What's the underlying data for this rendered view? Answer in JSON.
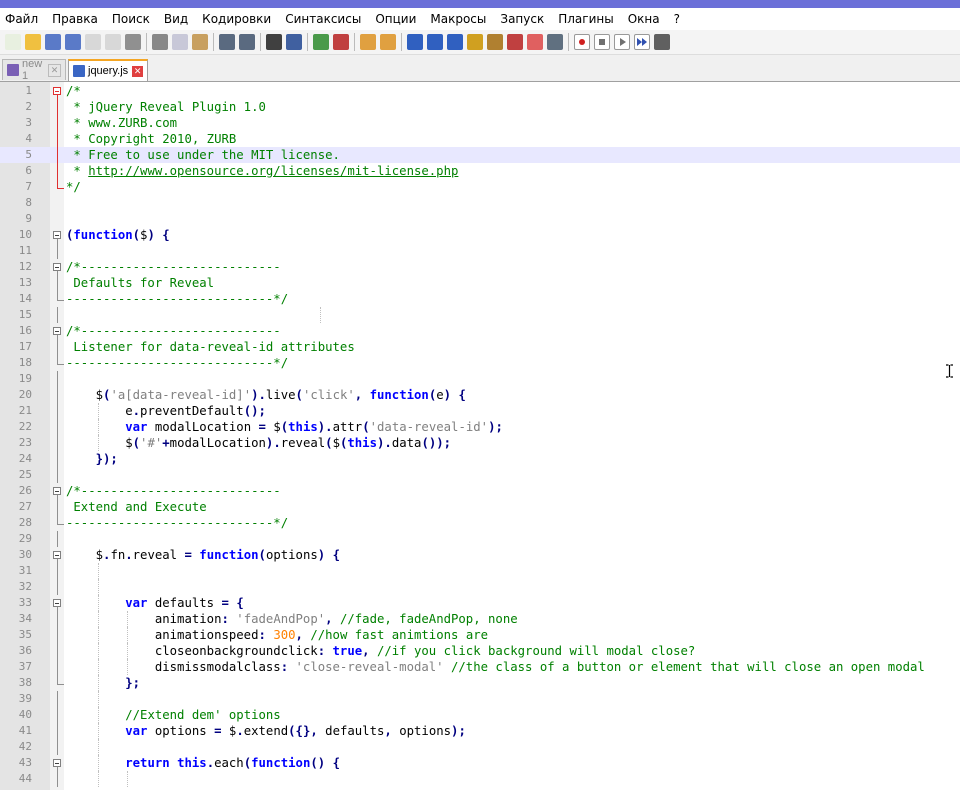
{
  "menu": [
    "Файл",
    "Правка",
    "Поиск",
    "Вид",
    "Кодировки",
    "Синтаксисы",
    "Опции",
    "Макросы",
    "Запуск",
    "Плагины",
    "Окна",
    "?"
  ],
  "toolbar_icons": [
    "new-file-icon",
    "open-file-icon",
    "save-icon",
    "save-all-icon",
    "close-icon",
    "close-all-icon",
    "print-icon",
    "cut-icon",
    "copy-icon",
    "paste-icon",
    "undo-icon",
    "redo-icon",
    "find-icon",
    "replace-icon",
    "zoom-in-icon",
    "zoom-out-icon",
    "sync-vertical-icon",
    "sync-horizontal-icon",
    "word-wrap-icon",
    "show-all-chars-icon",
    "indent-guide-icon",
    "user-lang-icon",
    "doc-map-icon",
    "function-list-icon",
    "folder-workspace-icon",
    "monitor-icon",
    "record-macro-icon",
    "stop-macro-icon",
    "play-macro-icon",
    "run-macro-multiple-icon",
    "save-macro-icon"
  ],
  "tabs": [
    {
      "label": "new 1",
      "active": false
    },
    {
      "label": "jquery.js",
      "active": true
    }
  ],
  "colors": {
    "comment": "#008000",
    "keyword": "#0000ff",
    "string": "#808080",
    "number": "#ff8000",
    "operator": "#000080",
    "fold_marker_red": "#e03030",
    "current_line": "#e8e8ff"
  },
  "editor": {
    "lines": [
      {
        "n": "1",
        "fold": "open-red",
        "segs": [
          [
            "cm",
            "/*"
          ]
        ]
      },
      {
        "n": "2",
        "fold": "line-red",
        "segs": [
          [
            "cm",
            " * jQuery Reveal Plugin 1.0"
          ]
        ]
      },
      {
        "n": "3",
        "fold": "line-red",
        "segs": [
          [
            "cm",
            " * www.ZURB.com"
          ]
        ]
      },
      {
        "n": "4",
        "fold": "line-red",
        "segs": [
          [
            "cm",
            " * Copyright 2010, ZURB"
          ]
        ]
      },
      {
        "n": "5",
        "fold": "line-red",
        "hl": true,
        "segs": [
          [
            "cm",
            " * Free to use under the MIT license."
          ]
        ]
      },
      {
        "n": "6",
        "fold": "line-red",
        "segs": [
          [
            "cm",
            " * "
          ],
          [
            "cmu",
            "http://www.opensource.org/licenses/mit-license.php"
          ]
        ]
      },
      {
        "n": "7",
        "fold": "end-red",
        "segs": [
          [
            "cm",
            "*/"
          ]
        ]
      },
      {
        "n": "8",
        "segs": []
      },
      {
        "n": "9",
        "segs": []
      },
      {
        "n": "10",
        "fold": "open",
        "segs": [
          [
            "op",
            "("
          ],
          [
            "kw",
            "function"
          ],
          [
            "op",
            "("
          ],
          [
            "",
            "$"
          ],
          [
            "op",
            ")"
          ],
          [
            "",
            " "
          ],
          [
            "op",
            "{"
          ]
        ]
      },
      {
        "n": "11",
        "fold": "line",
        "segs": []
      },
      {
        "n": "12",
        "fold": "open",
        "segs": [
          [
            "cm",
            "/*---------------------------"
          ]
        ]
      },
      {
        "n": "13",
        "fold": "line",
        "segs": [
          [
            "cm",
            " Defaults for Reveal"
          ]
        ]
      },
      {
        "n": "14",
        "fold": "end",
        "segs": [
          [
            "cm",
            "----------------------------*/"
          ]
        ]
      },
      {
        "n": "15",
        "fold": "line",
        "guides": [
          34
        ],
        "segs": []
      },
      {
        "n": "16",
        "fold": "open",
        "segs": [
          [
            "cm",
            "/*---------------------------"
          ]
        ]
      },
      {
        "n": "17",
        "fold": "line",
        "segs": [
          [
            "cm",
            " Listener for data-reveal-id attributes"
          ]
        ]
      },
      {
        "n": "18",
        "fold": "end",
        "segs": [
          [
            "cm",
            "----------------------------*/"
          ]
        ]
      },
      {
        "n": "19",
        "fold": "line",
        "segs": []
      },
      {
        "n": "20",
        "fold": "line",
        "segs": [
          [
            "",
            "    $"
          ],
          [
            "op",
            "("
          ],
          [
            "st",
            "'a[data-reveal-id]'"
          ],
          [
            "op",
            ")."
          ],
          [
            "",
            "live"
          ],
          [
            "op",
            "("
          ],
          [
            "st",
            "'click'"
          ],
          [
            "op",
            ", "
          ],
          [
            "kw",
            "function"
          ],
          [
            "op",
            "("
          ],
          [
            "",
            "e"
          ],
          [
            "op",
            ")"
          ],
          [
            "",
            " "
          ],
          [
            "op",
            "{"
          ]
        ]
      },
      {
        "n": "21",
        "fold": "line",
        "guides": [
          4
        ],
        "segs": [
          [
            "",
            "        e"
          ],
          [
            "op",
            "."
          ],
          [
            "",
            "preventDefault"
          ],
          [
            "op",
            "();"
          ]
        ]
      },
      {
        "n": "22",
        "fold": "line",
        "guides": [
          4
        ],
        "segs": [
          [
            "",
            " "
          ],
          [
            "kw",
            "       var"
          ],
          [
            "",
            " modalLocation "
          ],
          [
            "op",
            "="
          ],
          [
            "",
            " $"
          ],
          [
            "op",
            "("
          ],
          [
            "kw",
            "this"
          ],
          [
            "op",
            ")."
          ],
          [
            "",
            "attr"
          ],
          [
            "op",
            "("
          ],
          [
            "st",
            "'data-reveal-id'"
          ],
          [
            "op",
            ");"
          ]
        ]
      },
      {
        "n": "23",
        "fold": "line",
        "guides": [
          4
        ],
        "segs": [
          [
            "",
            "        $"
          ],
          [
            "op",
            "("
          ],
          [
            "st",
            "'#'"
          ],
          [
            "op",
            "+"
          ],
          [
            "",
            "modalLocation"
          ],
          [
            "op",
            ")."
          ],
          [
            "",
            "reveal"
          ],
          [
            "op",
            "("
          ],
          [
            "",
            "$"
          ],
          [
            "op",
            "("
          ],
          [
            "kw",
            "this"
          ],
          [
            "op",
            ")."
          ],
          [
            "",
            "data"
          ],
          [
            "op",
            "());"
          ]
        ]
      },
      {
        "n": "24",
        "fold": "line",
        "segs": [
          [
            "",
            "    "
          ],
          [
            "op",
            "});"
          ]
        ]
      },
      {
        "n": "25",
        "fold": "line",
        "segs": []
      },
      {
        "n": "26",
        "fold": "open",
        "segs": [
          [
            "cm",
            "/*---------------------------"
          ]
        ]
      },
      {
        "n": "27",
        "fold": "line",
        "segs": [
          [
            "cm",
            " Extend and Execute"
          ]
        ]
      },
      {
        "n": "28",
        "fold": "end",
        "segs": [
          [
            "cm",
            "----------------------------*/"
          ]
        ]
      },
      {
        "n": "29",
        "fold": "line",
        "segs": []
      },
      {
        "n": "30",
        "fold": "open",
        "segs": [
          [
            "",
            "    $"
          ],
          [
            "op",
            "."
          ],
          [
            "",
            "fn"
          ],
          [
            "op",
            "."
          ],
          [
            "",
            "reveal "
          ],
          [
            "op",
            "="
          ],
          [
            "",
            " "
          ],
          [
            "kw",
            "function"
          ],
          [
            "op",
            "("
          ],
          [
            "",
            "options"
          ],
          [
            "op",
            ")"
          ],
          [
            "",
            " "
          ],
          [
            "op",
            "{"
          ]
        ]
      },
      {
        "n": "31",
        "fold": "line",
        "guides": [
          4
        ],
        "segs": []
      },
      {
        "n": "32",
        "fold": "line",
        "guides": [
          4
        ],
        "segs": []
      },
      {
        "n": "33",
        "fold": "open",
        "guides": [
          4
        ],
        "segs": [
          [
            "",
            "        "
          ],
          [
            "kw",
            "var"
          ],
          [
            "",
            " defaults "
          ],
          [
            "op",
            "="
          ],
          [
            "",
            " "
          ],
          [
            "op",
            "{"
          ]
        ]
      },
      {
        "n": "34",
        "fold": "line",
        "guides": [
          4,
          8
        ],
        "segs": [
          [
            "",
            "            animation"
          ],
          [
            "op",
            ":"
          ],
          [
            "",
            " "
          ],
          [
            "st",
            "'fadeAndPop'"
          ],
          [
            "op",
            ","
          ],
          [
            "",
            " "
          ],
          [
            "cm",
            "//fade, fadeAndPop, none"
          ]
        ]
      },
      {
        "n": "35",
        "fold": "line",
        "guides": [
          4,
          8
        ],
        "segs": [
          [
            "",
            "            animationspeed"
          ],
          [
            "op",
            ":"
          ],
          [
            "",
            " "
          ],
          [
            "nm",
            "300"
          ],
          [
            "op",
            ","
          ],
          [
            "",
            " "
          ],
          [
            "cm",
            "//how fast animtions are"
          ]
        ]
      },
      {
        "n": "36",
        "fold": "line",
        "guides": [
          4,
          8
        ],
        "segs": [
          [
            "",
            "            closeonbackgroundclick"
          ],
          [
            "op",
            ":"
          ],
          [
            "",
            " "
          ],
          [
            "kw",
            "true"
          ],
          [
            "op",
            ","
          ],
          [
            "",
            " "
          ],
          [
            "cm",
            "//if you click background will modal close?"
          ]
        ]
      },
      {
        "n": "37",
        "fold": "line",
        "guides": [
          4,
          8
        ],
        "segs": [
          [
            "",
            "            dismissmodalclass"
          ],
          [
            "op",
            ":"
          ],
          [
            "",
            " "
          ],
          [
            "st",
            "'close-reveal-modal'"
          ],
          [
            "",
            " "
          ],
          [
            "cm",
            "//the class of a button or element that will close an open modal"
          ]
        ]
      },
      {
        "n": "38",
        "fold": "end",
        "guides": [
          4
        ],
        "segs": [
          [
            "",
            "        "
          ],
          [
            "op",
            "};"
          ]
        ]
      },
      {
        "n": "39",
        "fold": "line",
        "guides": [
          4
        ],
        "segs": []
      },
      {
        "n": "40",
        "fold": "line",
        "guides": [
          4
        ],
        "segs": [
          [
            "",
            "        "
          ],
          [
            "cm",
            "//Extend dem' options"
          ]
        ]
      },
      {
        "n": "41",
        "fold": "line",
        "guides": [
          4
        ],
        "segs": [
          [
            "",
            "        "
          ],
          [
            "kw",
            "var"
          ],
          [
            "",
            " options "
          ],
          [
            "op",
            "="
          ],
          [
            "",
            " $"
          ],
          [
            "op",
            "."
          ],
          [
            "",
            "extend"
          ],
          [
            "op",
            "({},"
          ],
          [
            "",
            " defaults"
          ],
          [
            "op",
            ","
          ],
          [
            "",
            " options"
          ],
          [
            "op",
            ");"
          ]
        ]
      },
      {
        "n": "42",
        "fold": "line",
        "guides": [
          4
        ],
        "segs": []
      },
      {
        "n": "43",
        "fold": "open",
        "guides": [
          4
        ],
        "segs": [
          [
            "",
            "        "
          ],
          [
            "kw",
            "return"
          ],
          [
            "",
            " "
          ],
          [
            "kw",
            "this"
          ],
          [
            "op",
            "."
          ],
          [
            "",
            "each"
          ],
          [
            "op",
            "("
          ],
          [
            "kw",
            "function"
          ],
          [
            "op",
            "()"
          ],
          [
            "",
            " "
          ],
          [
            "op",
            "{"
          ]
        ]
      },
      {
        "n": "44",
        "fold": "line",
        "guides": [
          4,
          8
        ],
        "segs": []
      }
    ]
  }
}
